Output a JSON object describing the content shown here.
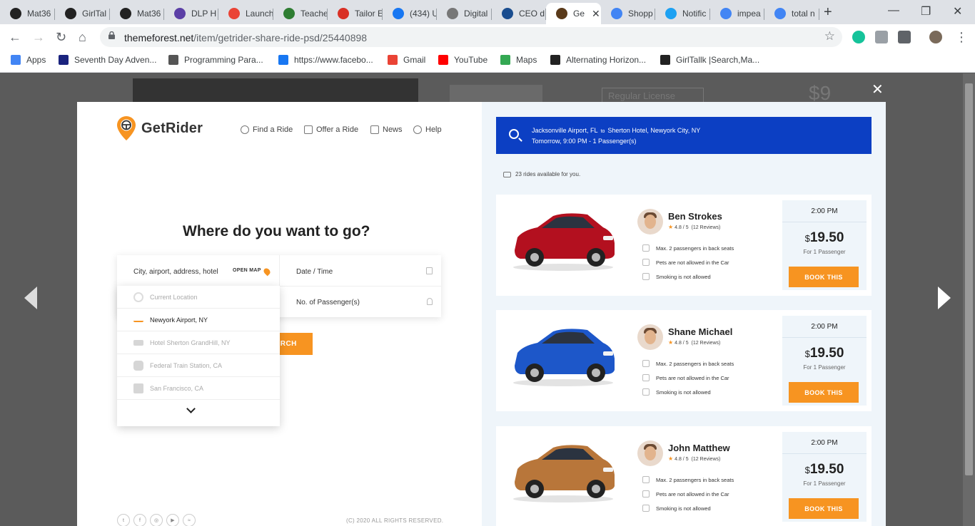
{
  "browser": {
    "tabs": [
      {
        "title": "Mat36",
        "color": "#222222"
      },
      {
        "title": "GirlTal",
        "color": "#222222"
      },
      {
        "title": "Mat36",
        "color": "#222222"
      },
      {
        "title": "DLP H",
        "color": "#5b3fa6"
      },
      {
        "title": "Launch",
        "color": "#ea4335"
      },
      {
        "title": "Teache",
        "color": "#2e7d32"
      },
      {
        "title": "Tailor E",
        "color": "#d93025"
      },
      {
        "title": "(434) U",
        "color": "#1877f2"
      },
      {
        "title": "Digital",
        "color": "#777777"
      },
      {
        "title": "CEO d",
        "color": "#1a4d8f"
      },
      {
        "title": "Ge",
        "color": "#5a3a1a"
      },
      {
        "title": "Shopp",
        "color": "#4285f4"
      },
      {
        "title": "Notific",
        "color": "#1da1f2"
      },
      {
        "title": "impea",
        "color": "#4285f4"
      },
      {
        "title": "total n",
        "color": "#4285f4"
      }
    ],
    "url_domain": "themeforest.net",
    "url_path": "/item/getrider-share-ride-psd/25440898",
    "bookmarks": [
      {
        "label": "Apps",
        "color": "#4285f4"
      },
      {
        "label": "Seventh Day Adven...",
        "color": "#1a237e"
      },
      {
        "label": "Programming Para...",
        "color": "#555555"
      },
      {
        "label": "https://www.facebo...",
        "color": "#1877f2"
      },
      {
        "label": "Gmail",
        "color": "#ea4335"
      },
      {
        "label": "YouTube",
        "color": "#ff0000"
      },
      {
        "label": "Maps",
        "color": "#34a853"
      },
      {
        "label": "Alternating Horizon...",
        "color": "#222222"
      },
      {
        "label": "GirlTallk |Search,Ma...",
        "color": "#222222"
      }
    ]
  },
  "behind": {
    "license": "Regular License",
    "price": "$9"
  },
  "overlay": {
    "close": "✕"
  },
  "site": {
    "logo": "GetRider",
    "nav": [
      "Find a Ride",
      "Offer a Ride",
      "News",
      "Help"
    ],
    "hero": "Where do you want to go?",
    "from_placeholder": "City, airport, address, hotel",
    "open_map": "OPEN MAP",
    "date_label": "Date / Time",
    "passengers_label": "No. of Passenger(s)",
    "search_btn": "ARCH",
    "dropdown": [
      {
        "label": "Current Location",
        "icon": "location-icon"
      },
      {
        "label": "Newyork Airport, NY",
        "icon": "plane-icon"
      },
      {
        "label": "Hotel Sherton GrandHill, NY",
        "icon": "bed-icon"
      },
      {
        "label": "Federal Train Station, CA",
        "icon": "train-icon"
      },
      {
        "label": "San Francisco, CA",
        "icon": "city-icon"
      }
    ],
    "copyright": "(C) 2020 ALL RIGHTS RESERVED.",
    "socials": [
      "twitter-icon",
      "facebook-icon",
      "instagram-icon",
      "youtube-icon",
      "rss-icon"
    ]
  },
  "results": {
    "from": "Jacksonville  Airport, FL",
    "to_word": "to",
    "to": "Sherton Hotel, Newyork City, NY",
    "when": "Tomorrow, 9:00 PM - 1 Passenger(s)",
    "available": "23 rides available for you.",
    "rides": [
      {
        "driver": "Ben Strokes",
        "rating": "4.8 / 5",
        "reviews": "(12 Reviews)",
        "features": [
          "Max. 2 passengers in back seats",
          "Pets are not allowed in the Car",
          "Smoking is not allowed"
        ],
        "time": "2:00 PM",
        "currency": "$",
        "price": "19.50",
        "per": "For 1 Passenger",
        "book": "BOOK THIS",
        "car_color": "#b3101f"
      },
      {
        "driver": "Shane Michael",
        "rating": "4.8 / 5",
        "reviews": "(12 Reviews)",
        "features": [
          "Max. 2 passengers in back seats",
          "Pets are not allowed in the Car",
          "Smoking is not allowed"
        ],
        "time": "2:00 PM",
        "currency": "$",
        "price": "19.50",
        "per": "For 1 Passenger",
        "book": "BOOK THIS",
        "car_color": "#1d57c9"
      },
      {
        "driver": "John Matthew",
        "rating": "4.8 / 5",
        "reviews": "(12 Reviews)",
        "features": [
          "Max. 2 passengers in back seats",
          "Pets are not allowed in the Car",
          "Smoking is not allowed"
        ],
        "time": "2:00 PM",
        "currency": "$",
        "price": "19.50",
        "per": "For 1 Passenger",
        "book": "BOOK THIS",
        "car_color": "#b8763a"
      }
    ]
  },
  "colors": {
    "accent": "#f79421",
    "search_bar": "#0c3fc3",
    "pane_bg": "#eff5fa"
  }
}
